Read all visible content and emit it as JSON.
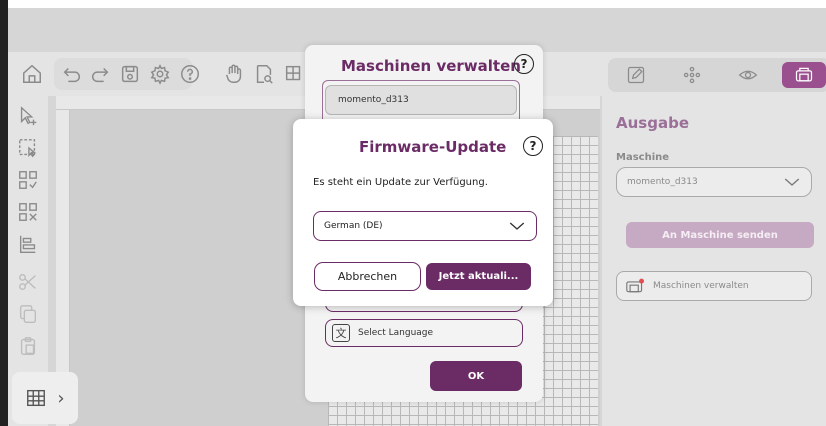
{
  "right_panel": {
    "section_title": "Ausgabe",
    "machine_label": "Maschine",
    "machine_value": "momento_d313",
    "send_button": "An Maschine senden",
    "manage_button": "Maschinen verwalten"
  },
  "machines_dialog": {
    "title": "Maschinen verwalten",
    "help": "?",
    "machine_item": "momento_d313",
    "select_language": "Select Language",
    "ok_button": "OK"
  },
  "firmware_dialog": {
    "title": "Firmware-Update",
    "help": "?",
    "message": "Es steht ein Update zur Verfügung.",
    "language_value": "German (DE)",
    "cancel_button": "Abbrechen",
    "update_button": "Jetzt aktuali..."
  },
  "colors": {
    "accent": "#6b2c66",
    "accent_light": "#9a6f98"
  }
}
